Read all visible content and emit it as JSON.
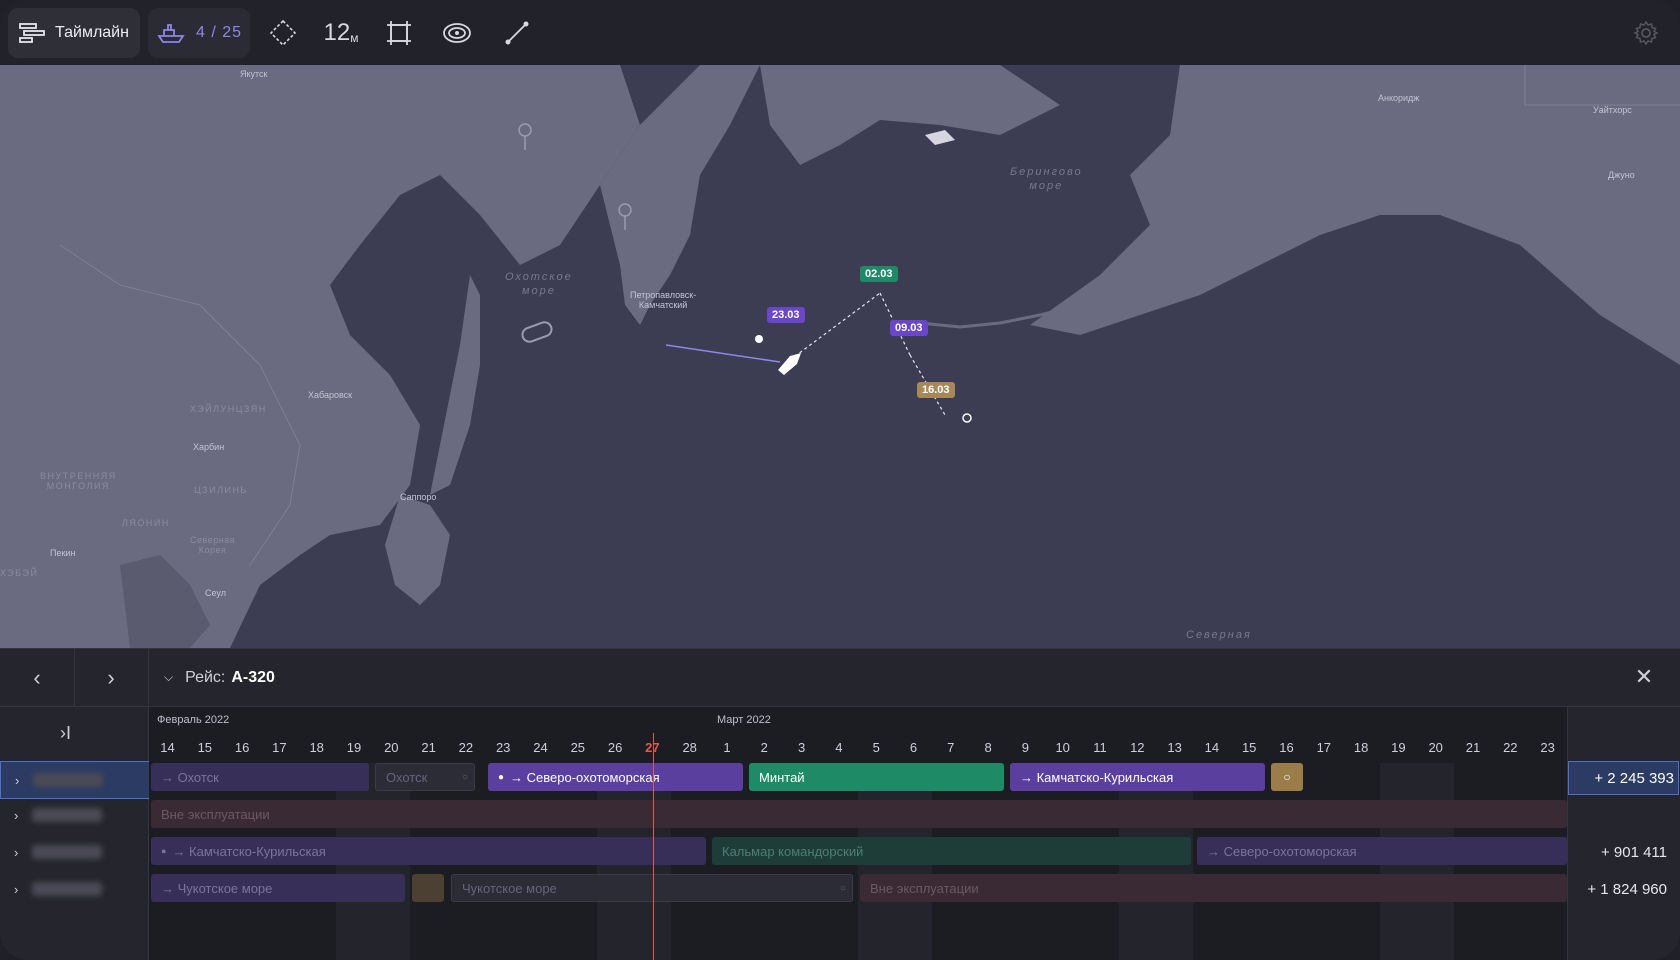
{
  "toolbar": {
    "timeline_label": "Таймлайн",
    "vessels_counter": "4 / 25",
    "distance_label": "12",
    "distance_unit": "м"
  },
  "map": {
    "cities": {
      "yakutsk": "Якутск",
      "anchorage": "Анкоридж",
      "whitehorse": "Уайтхорс",
      "juneau": "Джуно",
      "petropavlovsk": "Петропавловск-\nКамчатский",
      "khabarovsk": "Хабаровск",
      "harbin": "Харбин",
      "sapporo": "Саппоро",
      "beijing": "Пекин",
      "seoul": "Сеул"
    },
    "regions": {
      "heilongjiang": "хэйлунцзян",
      "inner_mongolia": "внутренняя\nмонголия",
      "jilin": "цзилинь",
      "liaoning": "ляонин",
      "north_korea": "Северная\nКорея",
      "hebei": "хэбэй"
    },
    "seas": {
      "okhotsk": "Охотское\nморе",
      "bering": "Берингово\nморе",
      "north": "Северная"
    },
    "route_dates": {
      "d1": "23.03",
      "d2": "02.03",
      "d3": "09.03",
      "d4": "16.03"
    }
  },
  "panel": {
    "trip_prefix": "Рейс:",
    "trip_id": "А-320",
    "months": {
      "feb": "Февраль 2022",
      "mar": "Март 2022"
    },
    "days": [
      "14",
      "15",
      "16",
      "17",
      "18",
      "19",
      "20",
      "21",
      "22",
      "23",
      "24",
      "25",
      "26",
      "27",
      "28",
      "1",
      "2",
      "3",
      "4",
      "5",
      "6",
      "7",
      "8",
      "9",
      "10",
      "11",
      "12",
      "13",
      "14",
      "15",
      "16",
      "17",
      "18",
      "19",
      "20",
      "21",
      "22",
      "23"
    ],
    "today_index": 13,
    "rows": [
      {
        "total": "+ 2 245 393",
        "bars": {
          "okhotsk_1": "→ Охотск",
          "okhotsk_2": "Охотск",
          "north_okhotsk": "→ Северо-охотоморская",
          "pollock": "Минтай",
          "kamchatka_kuril": "→ Камчатско-Курильская"
        }
      },
      {
        "total": "",
        "bars": {
          "out_of_service": "Вне эксплуатации"
        }
      },
      {
        "total": "+ 901 411",
        "bars": {
          "kamchatka_kuril": "→ Камчатско-Курильская",
          "squid": "Кальмар командорский",
          "north_okhotsk": "→ Северо-охотоморская"
        }
      },
      {
        "total": "+ 1 824 960",
        "bars": {
          "chukchi_1": "→ Чукотское море",
          "chukchi_2": "Чукотское море",
          "out_of_service": "Вне эксплуатации"
        }
      }
    ]
  },
  "colors": {
    "accent_purple": "#5a3f9e",
    "accent_green": "#1f8a66",
    "accent_gold": "#9b7d4a",
    "today_red": "#e05a4d",
    "selection_blue": "#4f6fd0"
  }
}
